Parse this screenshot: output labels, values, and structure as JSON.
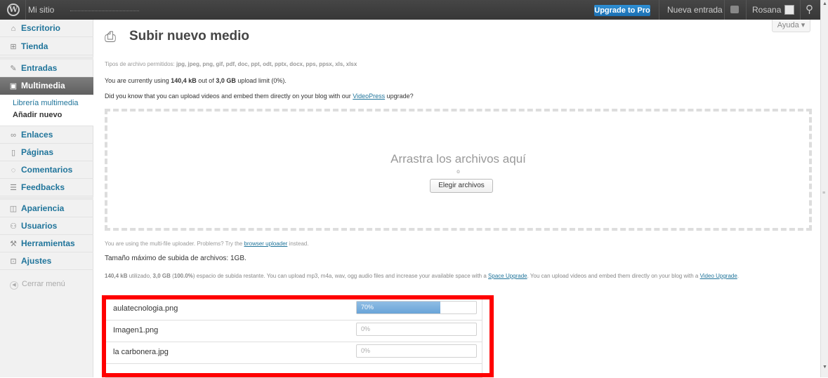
{
  "adminbar": {
    "site": "Mi sitio",
    "upgrade": "Upgrade to Pro",
    "new_post": "Nueva entrada",
    "user": "Rosana"
  },
  "sidebar": {
    "items": [
      {
        "label": "Escritorio",
        "icon": "home-icon"
      },
      {
        "label": "Tienda",
        "icon": "cart-icon"
      },
      {
        "label": "Entradas",
        "icon": "pin-icon"
      },
      {
        "label": "Multimedia",
        "icon": "media-icon"
      },
      {
        "label": "Enlaces",
        "icon": "link-icon"
      },
      {
        "label": "Páginas",
        "icon": "page-icon"
      },
      {
        "label": "Comentarios",
        "icon": "comment-icon"
      },
      {
        "label": "Feedbacks",
        "icon": "feedback-icon"
      },
      {
        "label": "Apariencia",
        "icon": "appearance-icon"
      },
      {
        "label": "Usuarios",
        "icon": "users-icon"
      },
      {
        "label": "Herramientas",
        "icon": "tools-icon"
      },
      {
        "label": "Ajustes",
        "icon": "settings-icon"
      }
    ],
    "sub": [
      "Librería multimedia",
      "Añadir nuevo"
    ],
    "collapse": "Cerrar menú"
  },
  "main": {
    "help": "Ayuda",
    "title": "Subir nuevo medio",
    "allowed_prefix": "Tipos de archivo permitidos:",
    "allowed_types": "jpg, jpeg, png, gif, pdf, doc, ppt, odt, pptx, docx, pps, ppsx, xls, xlsx",
    "using_1": "You are currently using",
    "using_amount": "140,4 kB",
    "using_2": "out of",
    "using_limit": "3,0 GB",
    "using_3": "upload limit (0%).",
    "did_1": "Did you know that you can upload videos and embed them directly on your blog with our",
    "did_link": "VideoPress",
    "did_2": "upgrade?",
    "drop_title": "Arrastra los archivos aquí",
    "drop_or": "o",
    "choose": "Elegir archivos",
    "multi_1": "You are using the multi-file uploader. Problems? Try the",
    "multi_link": "browser uploader",
    "multi_2": "instead.",
    "max_size": "Tamaño máximo de subida de archivos: 1GB.",
    "space_used": "140,4 kB",
    "space_used_suffix": "utilizado,",
    "space_total": "3,0 GB",
    "space_pct": "100.0%",
    "space_1": "espacio de subida restante. You can upload mp3, m4a, wav, ogg audio files and increase your available space with a",
    "space_link": "Space Upgrade",
    "space_2": ". You can upload videos and embed them directly on your blog with a",
    "space_link2": "Video Upgrade",
    "space_3": "."
  },
  "uploads": [
    {
      "name": "aulatecnologia.png",
      "progress": 70,
      "label": "70%"
    },
    {
      "name": "Imagen1.png",
      "progress": 0,
      "label": "0%"
    },
    {
      "name": "la carbonera.jpg",
      "progress": 0,
      "label": "0%"
    }
  ],
  "colors": {
    "highlight": "#ff0000",
    "link": "#21759b",
    "progress": "#69a4d8"
  }
}
